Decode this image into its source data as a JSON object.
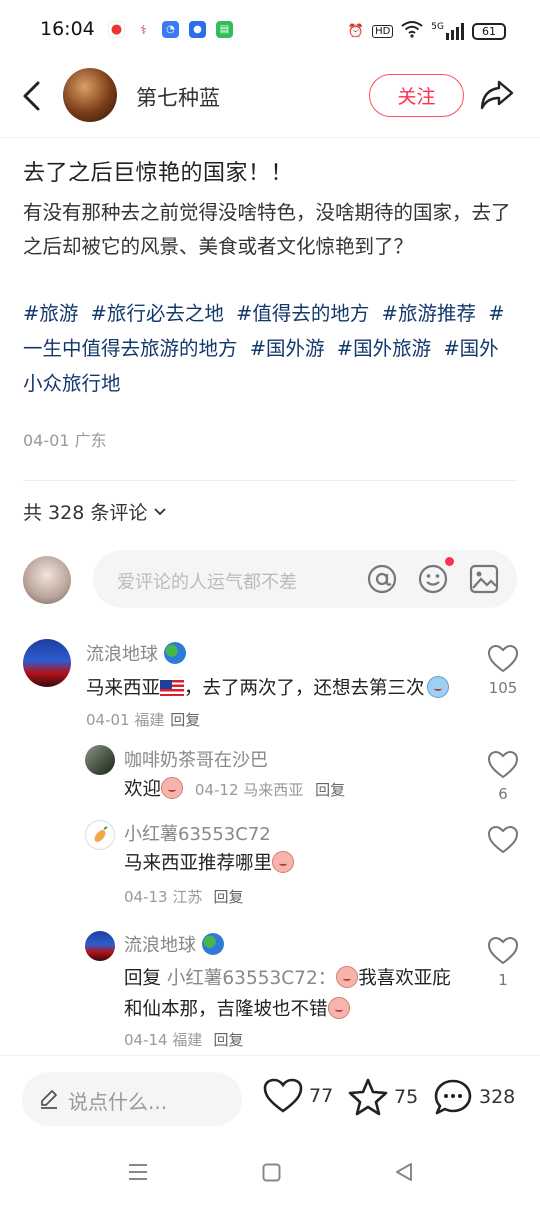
{
  "status": {
    "time": "16:04",
    "battery": "61",
    "net": "5G"
  },
  "header": {
    "author": "第七种蓝",
    "follow_label": "关注"
  },
  "post": {
    "title": "去了之后巨惊艳的国家！！",
    "body": "有没有那种去之前觉得没啥特色，没啥期待的国家，去了之后却被它的风景、美食或者文化惊艳到了？",
    "tags": [
      "#旅游",
      "#旅行必去之地",
      "#值得去的地方",
      "#旅游推荐",
      "#一生中值得去旅游的地方",
      "#国外游",
      "#国外旅游",
      "#国外小众旅行地"
    ],
    "meta": "04-01 广东"
  },
  "comments_header": {
    "count_label": "共 328 条评论"
  },
  "comment_input": {
    "placeholder": "爱评论的人运气都不差"
  },
  "comments": [
    {
      "name": "流浪地球",
      "text_a": "马来西亚",
      "text_b": "，去了两次了，还想去第三次",
      "meta": "04-01 福建",
      "reply": "回复",
      "likes": "105"
    },
    {
      "name": "咖啡奶茶哥在沙巴",
      "text": "欢迎",
      "meta": "04-12 马来西亚",
      "reply": "回复",
      "likes": "6"
    },
    {
      "name": "小红薯63553C72",
      "text": "马来西亚推荐哪里",
      "meta": "04-13 江苏",
      "reply": "回复",
      "likes": ""
    },
    {
      "name": "流浪地球",
      "reply_prefix": "回复",
      "reply_to": "小红薯63553C72：",
      "text_a": "我喜欢亚庇和仙本那，吉隆坡也不错",
      "meta": "04-14 福建",
      "reply": "回复",
      "likes": "1"
    }
  ],
  "bottom_bar": {
    "say_placeholder": "说点什么...",
    "likes": "77",
    "stars": "75",
    "comments": "328"
  }
}
